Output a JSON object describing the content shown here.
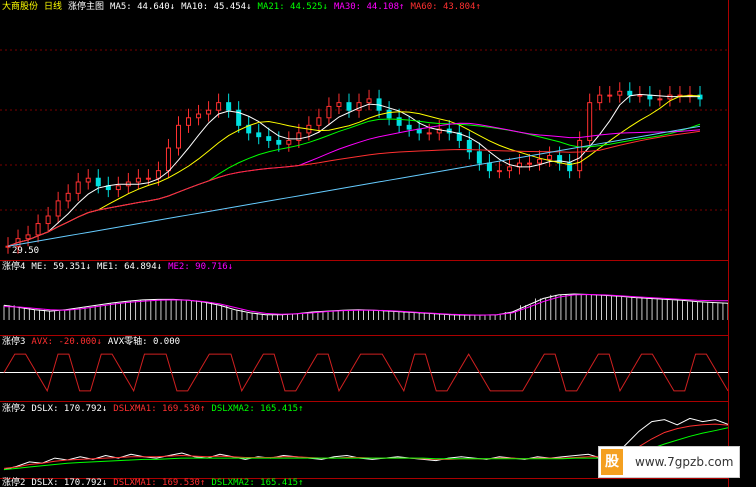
{
  "header_main": {
    "stock": "大商股份",
    "period": "日线",
    "indicator": "涨停主图",
    "items": [
      {
        "label": "MA5: 44.640↓",
        "color": "#ffffff"
      },
      {
        "label": "MA10: 45.454↓",
        "color": "#ffffff"
      },
      {
        "label": "MA21: 44.525↓",
        "color": "#00ff00"
      },
      {
        "label": "MA30: 44.108↑",
        "color": "#ff00ff"
      },
      {
        "label": "MA60: 43.804↑",
        "color": "#ff3030"
      }
    ]
  },
  "header_sub1": {
    "indicator": "涨停4",
    "items": [
      {
        "label": "ME: 59.351↓",
        "color": "#ffffff"
      },
      {
        "label": "ME1: 64.894↓",
        "color": "#ffffff"
      },
      {
        "label": "ME2: 90.716↓",
        "color": "#ff00ff"
      }
    ]
  },
  "header_sub2": {
    "indicator": "涨停3",
    "items": [
      {
        "label": "AVX: -20.000↓",
        "color": "#ff3030"
      },
      {
        "label": "AVX零轴: 0.000",
        "color": "#ffffff"
      }
    ]
  },
  "header_sub3": {
    "indicator": "涨停2",
    "items": [
      {
        "label": "DSLX: 170.792↓",
        "color": "#ffffff"
      },
      {
        "label": "DSLXMA1: 169.530↑",
        "color": "#ff3030"
      },
      {
        "label": "DSLXMA2: 165.415↑",
        "color": "#00ff00"
      }
    ]
  },
  "header_sub4": {
    "indicator": "涨停2",
    "items": [
      {
        "label": "DSLX: 170.792↓",
        "color": "#ffffff"
      },
      {
        "label": "DSLXMA1: 169.530↑",
        "color": "#ff3030"
      },
      {
        "label": "DSLXMA2: 165.415↑",
        "color": "#00ff00"
      }
    ]
  },
  "price_low_label": "29.50",
  "watermark": {
    "logo": "股",
    "url": "www.7gpzb.com"
  },
  "chart_data": [
    {
      "type": "line",
      "title": "涨停主图",
      "note": "candlestick main panel; values approximate",
      "close": [
        30,
        31,
        31.5,
        33,
        34,
        36,
        37,
        38.5,
        39,
        38,
        37.5,
        38,
        38.5,
        39,
        39,
        40,
        43,
        46,
        47,
        47.5,
        48,
        49,
        48,
        46,
        45,
        44.5,
        44,
        43.5,
        44,
        45,
        46,
        47,
        48.5,
        49,
        48,
        49,
        49.5,
        48,
        47,
        46,
        45.5,
        45,
        45,
        45.5,
        45,
        44,
        42.5,
        41,
        40,
        40,
        40.5,
        41,
        41,
        41.5,
        42,
        41,
        40,
        44,
        49,
        50,
        50,
        50.5,
        50,
        50,
        49.5,
        49.5,
        50,
        50,
        50,
        49.5
      ],
      "series": [
        {
          "name": "MA5",
          "values": [
            44.64
          ]
        },
        {
          "name": "MA10",
          "values": [
            45.454
          ]
        },
        {
          "name": "MA21",
          "values": [
            44.525
          ]
        },
        {
          "name": "MA30",
          "values": [
            44.108
          ]
        },
        {
          "name": "MA60",
          "values": [
            43.804
          ]
        }
      ],
      "ylim": [
        29.5,
        52
      ]
    },
    {
      "type": "line",
      "title": "涨停4",
      "series": [
        {
          "name": "ME",
          "values": [
            55,
            50,
            45,
            42,
            45,
            50,
            55,
            60,
            64,
            67,
            68,
            68,
            66,
            62,
            55,
            45,
            38,
            34,
            34,
            36,
            40,
            42,
            44,
            45,
            44,
            42,
            40,
            38,
            36,
            34,
            33,
            33,
            34,
            40,
            55,
            70,
            78,
            80,
            79,
            77,
            75,
            72,
            70,
            68,
            66,
            63,
            61,
            59.351
          ]
        },
        {
          "name": "ME1",
          "values": [
            52,
            51,
            48,
            45,
            44,
            47,
            52,
            57,
            61,
            64,
            66,
            67,
            66,
            63,
            58,
            50,
            42,
            37,
            35,
            36,
            38,
            41,
            43,
            44,
            44,
            43,
            41,
            39,
            37,
            35,
            34,
            33,
            34,
            38,
            50,
            63,
            73,
            78,
            79,
            78,
            76,
            74,
            72,
            70,
            68,
            66,
            65,
            64.894
          ]
        },
        {
          "name": "ME2",
          "values": [
            90.716
          ]
        }
      ],
      "ylim": [
        0,
        100
      ]
    },
    {
      "type": "line",
      "title": "涨停3",
      "series": [
        {
          "name": "AVX",
          "values": [
            0,
            20,
            20,
            0,
            -20,
            20,
            20,
            -20,
            -20,
            20,
            20,
            0,
            -20,
            20,
            20,
            20,
            -20,
            -20,
            0,
            20,
            20,
            20,
            -20,
            0,
            20,
            20,
            -20,
            -20,
            0,
            20,
            20,
            -20,
            0,
            20,
            20,
            20,
            0,
            -20,
            20,
            20,
            -20,
            -20,
            0,
            20,
            0,
            -20,
            -20,
            -20,
            -20,
            0,
            20,
            20,
            -20,
            -20,
            0,
            20,
            20,
            -20,
            0,
            20,
            20,
            0,
            -20,
            -20,
            20,
            20,
            0,
            -20
          ]
        },
        {
          "name": "AVX零轴",
          "values": [
            0.0
          ]
        }
      ],
      "ylim": [
        -30,
        30
      ]
    },
    {
      "type": "line",
      "title": "涨停2",
      "series": [
        {
          "name": "DSLX",
          "values": [
            100,
            105,
            112,
            110,
            118,
            115,
            120,
            116,
            122,
            118,
            124,
            120,
            118,
            122,
            126,
            120,
            118,
            124,
            120,
            116,
            120,
            118,
            122,
            120,
            118,
            116,
            120,
            122,
            118,
            116,
            118,
            120,
            118,
            116,
            114,
            118,
            120,
            118,
            116,
            120,
            118,
            116,
            120,
            118,
            120,
            122,
            124,
            118,
            120,
            140,
            160,
            175,
            178,
            170,
            180,
            175,
            178,
            170.792
          ]
        },
        {
          "name": "DSLXMA1",
          "values": [
            102,
            104,
            108,
            110,
            113,
            115,
            116,
            117,
            118,
            119,
            120,
            120,
            120,
            121,
            122,
            121,
            120,
            121,
            120,
            119,
            119,
            119,
            120,
            120,
            119,
            118,
            118,
            119,
            119,
            118,
            118,
            118,
            118,
            117,
            116,
            116,
            117,
            117,
            117,
            118,
            118,
            117,
            118,
            118,
            118,
            119,
            120,
            120,
            120,
            126,
            136,
            148,
            158,
            164,
            168,
            170,
            171,
            169.53
          ]
        },
        {
          "name": "DSLXMA2",
          "values": [
            100,
            102,
            104,
            106,
            108,
            110,
            111,
            112,
            113,
            114,
            115,
            116,
            116,
            117,
            118,
            118,
            118,
            118,
            118,
            118,
            118,
            118,
            118,
            118,
            118,
            118,
            118,
            118,
            118,
            118,
            118,
            118,
            118,
            118,
            117,
            117,
            117,
            117,
            117,
            117,
            117,
            117,
            117,
            117,
            117,
            118,
            118,
            118,
            118,
            121,
            126,
            133,
            140,
            146,
            152,
            157,
            161,
            165.415
          ]
        }
      ],
      "ylim": [
        90,
        190
      ]
    }
  ]
}
